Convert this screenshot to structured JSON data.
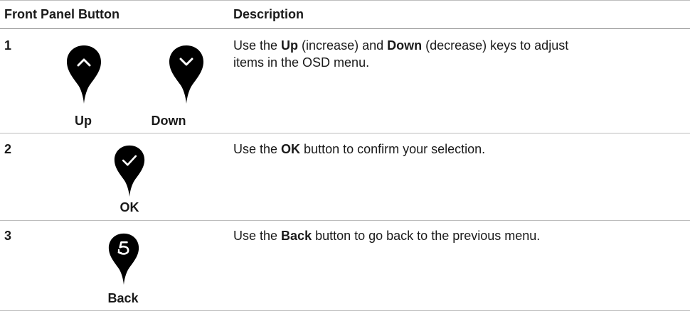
{
  "table": {
    "header": {
      "col1": "Front Panel Button",
      "col2": "Description"
    },
    "rows": [
      {
        "number": "1",
        "labels": [
          "Up",
          "Down"
        ],
        "icons": [
          "chevron-up-icon",
          "chevron-down-icon"
        ],
        "desc": {
          "p1": "Use the ",
          "b1": "Up",
          "p2": " (increase) and ",
          "b2": "Down",
          "p3": " (decrease) keys to adjust",
          "line2": "items in the OSD menu."
        }
      },
      {
        "number": "2",
        "labels": [
          "OK"
        ],
        "icons": [
          "checkmark-icon"
        ],
        "desc": {
          "p1": "Use the ",
          "b1": "OK",
          "p2": " button to confirm your selection."
        }
      },
      {
        "number": "3",
        "labels": [
          "Back"
        ],
        "icons": [
          "back-arrow-icon"
        ],
        "desc": {
          "p1": "Use the ",
          "b1": "Back",
          "p2": " button to go back to the previous menu."
        }
      }
    ]
  }
}
